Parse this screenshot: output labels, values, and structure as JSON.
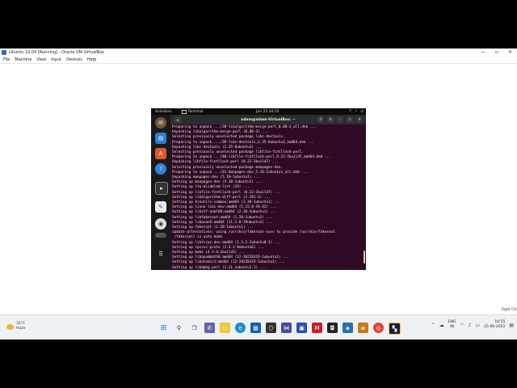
{
  "host": {
    "window_title": "Ubuntu 22.04 [Running] - Oracle VM VirtualBox",
    "window_controls": [
      "—",
      "▫",
      "✕"
    ],
    "menu": [
      "File",
      "Machine",
      "View",
      "Input",
      "Devices",
      "Help"
    ],
    "host_key": "Right Ctrl"
  },
  "guest": {
    "activities": "Activities",
    "terminal_indicator": "Terminal",
    "clock": "Jun 25  10:55",
    "terminal_title": "adam@adam-VirtualBox: ~",
    "terminal_lines": [
      "Preparing to unpack .../38-libalgorithm-merge-perl_0.08-3_all.deb ...",
      "Unpacking libalgorithm-merge-perl (0.08-3) ...",
      "Selecting previously unselected package libc-devtools.",
      "Preparing to unpack .../39-libc-devtools_2.35-0ubuntu3_amd64.deb ...",
      "Unpacking libc-devtools (2.35-0ubuntu3) ...",
      "Selecting previously unselected package libfile-fcntllock-perl.",
      "Preparing to unpack .../40-libfile-fcntllock-perl_0.22-3build7_amd64.deb ...",
      "Unpacking libfile-fcntllock-perl (0.22-3build7) ...",
      "Selecting previously unselected package manpages-dev.",
      "Preparing to unpack .../41-manpages-dev_5.10-1ubuntu1_all.deb ...",
      "Unpacking manpages-dev (5.10-1ubuntu1) ...",
      "Setting up manpages-dev (5.10-1ubuntu1) ...",
      "Setting up lto-disabled-list (24) ...",
      "Setting up libfile-fcntllock-perl (0.22-3build7) ...",
      "Setting up libalgorithm-diff-perl (1.201-1) ...",
      "Setting up binutils-common:amd64 (2.38-3ubuntu1) ...",
      "Setting up linux-libc-dev:amd64 (5.15.0-39.42) ...",
      "Setting up libctf-nobfd0:amd64 (2.38-3ubuntu1) ...",
      "Setting up libfakeroot:amd64 (1.28-1ubuntu1) ...",
      "Setting up libasan6:amd64 (11.2.0-19ubuntu1) ...",
      "Setting up fakeroot (1.28-1ubuntu1) ...",
      "update-alternatives: using /usr/bin/fakeroot-sysv to provide /usr/bin/fakeroot",
      " (fakeroot) in auto mode",
      "Setting up libtirpc-dev:amd64 (1.3.2-2ubuntu0.1) ...",
      "Setting up rpcsvc-proto (1.4.2-0ubuntu6) ...",
      "Setting up make (4.3-4.1build1) ...",
      "Setting up libquadmath0:amd64 (12-20220319-1ubuntu1) ...",
      "Setting up libatomic1:amd64 (12-20220319-1ubuntu1) ...",
      "Setting up libdpkg-perl (1.21.1ubuntu2.1) ..."
    ]
  },
  "taskbar": {
    "weather_temp": "33°C",
    "weather_desc": "Haze",
    "lang_top": "ENG",
    "lang_bottom": "IN",
    "time": "10:55",
    "date": "25-06-2022"
  },
  "colors": {
    "terminal_bg": "#300a24",
    "terminal_fg": "#e8e8e8",
    "dock_bg": "#1a1a1a",
    "taskbar_bg": "#eef2f6"
  }
}
